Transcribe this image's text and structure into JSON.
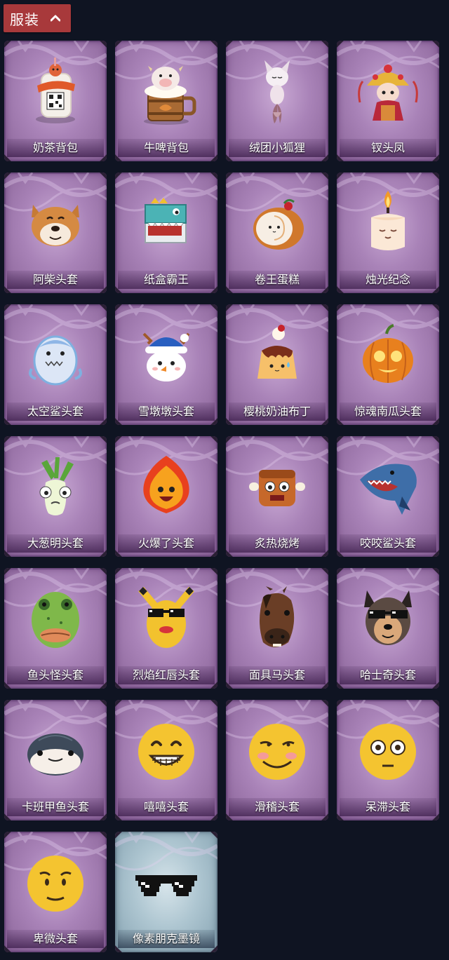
{
  "header": {
    "label": "服装",
    "chevron_icon": "chevron-up-icon"
  },
  "items": [
    {
      "name": "奶茶背包",
      "icon": "milk-tea-backpack-icon",
      "rarity": "purple"
    },
    {
      "name": "牛啤背包",
      "icon": "cow-beer-backpack-icon",
      "rarity": "purple"
    },
    {
      "name": "绒团小狐狸",
      "icon": "fluffy-fox-icon",
      "rarity": "purple"
    },
    {
      "name": "钗头凤",
      "icon": "phoenix-hairpin-icon",
      "rarity": "purple"
    },
    {
      "name": "阿柴头套",
      "icon": "shiba-mask-icon",
      "rarity": "purple"
    },
    {
      "name": "纸盒霸王",
      "icon": "box-dino-icon",
      "rarity": "purple"
    },
    {
      "name": "卷王蛋糕",
      "icon": "roll-cake-icon",
      "rarity": "purple"
    },
    {
      "name": "烛光纪念",
      "icon": "candle-icon",
      "rarity": "purple"
    },
    {
      "name": "太空鲨头套",
      "icon": "space-shark-icon",
      "rarity": "purple"
    },
    {
      "name": "雪墩墩头套",
      "icon": "snowman-icon",
      "rarity": "purple"
    },
    {
      "name": "樱桃奶油布丁",
      "icon": "pudding-icon",
      "rarity": "purple"
    },
    {
      "name": "惊魂南瓜头套",
      "icon": "pumpkin-icon",
      "rarity": "purple"
    },
    {
      "name": "大葱明头套",
      "icon": "scallion-icon",
      "rarity": "purple"
    },
    {
      "name": "火爆了头套",
      "icon": "fireball-icon",
      "rarity": "purple"
    },
    {
      "name": "炙热烧烤",
      "icon": "bbq-meat-icon",
      "rarity": "purple"
    },
    {
      "name": "咬咬鲨头套",
      "icon": "biting-shark-icon",
      "rarity": "purple"
    },
    {
      "name": "鱼头怪头套",
      "icon": "fish-head-icon",
      "rarity": "purple"
    },
    {
      "name": "烈焰红唇头套",
      "icon": "yellow-lips-mask-icon",
      "rarity": "purple"
    },
    {
      "name": "面具马头套",
      "icon": "horse-mask-icon",
      "rarity": "purple"
    },
    {
      "name": "哈士奇头套",
      "icon": "husky-mask-icon",
      "rarity": "purple"
    },
    {
      "name": "卡班甲鱼头套",
      "icon": "turtle-mask-icon",
      "rarity": "purple"
    },
    {
      "name": "嘻嘻头套",
      "icon": "grin-emoji-icon",
      "rarity": "purple"
    },
    {
      "name": "滑稽头套",
      "icon": "funny-emoji-icon",
      "rarity": "purple"
    },
    {
      "name": "呆滞头套",
      "icon": "stunned-emoji-icon",
      "rarity": "purple"
    },
    {
      "name": "卑微头套",
      "icon": "humble-emoji-icon",
      "rarity": "purple"
    },
    {
      "name": "像素朋克墨镜",
      "icon": "pixel-sunglasses-icon",
      "rarity": "blue"
    }
  ]
}
